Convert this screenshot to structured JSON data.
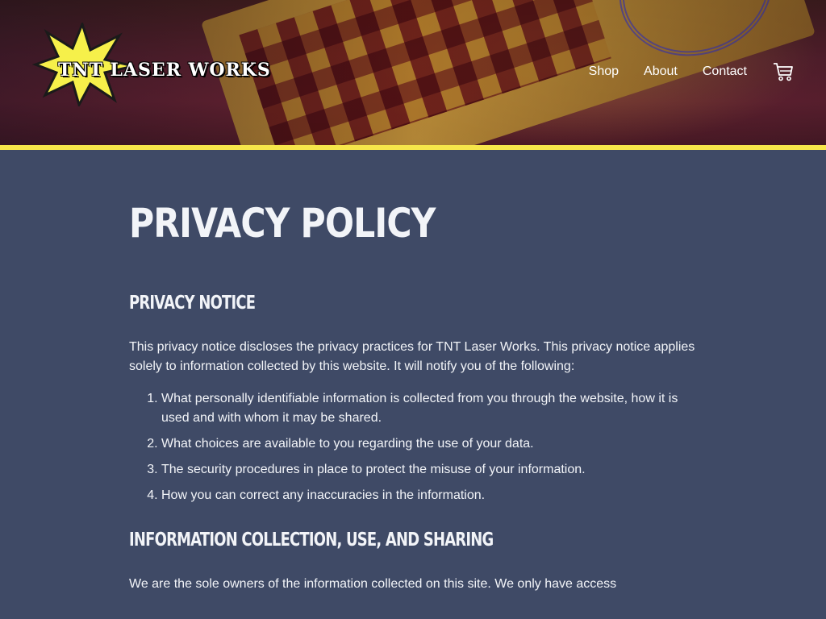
{
  "site": {
    "logo_text": "TNT LASER WORKS"
  },
  "nav": {
    "items": [
      {
        "label": "Shop"
      },
      {
        "label": "About"
      },
      {
        "label": "Contact"
      }
    ],
    "cart_icon": "shopping-cart-icon"
  },
  "colors": {
    "accent_stripe": "#f6e64a",
    "page_background": "#3f4a66",
    "logo_star": "#f6f04a"
  },
  "main": {
    "title": "PRIVACY POLICY",
    "sections": [
      {
        "heading": "PRIVACY NOTICE",
        "intro": "This privacy notice discloses the privacy practices for TNT Laser Works. This privacy notice applies solely to information collected by this website. It will notify you of the following:",
        "list": [
          "What personally identifiable information is collected from you through the website, how it is used and with whom it may be shared.",
          "What choices are available to you regarding the use of your data.",
          "The security procedures in place to protect the misuse of your information.",
          "How you can correct any inaccuracies in the information."
        ]
      },
      {
        "heading": "INFORMATION COLLECTION, USE, AND SHARING",
        "intro": "We are the sole owners of the information collected on this site. We only have access"
      }
    ]
  }
}
